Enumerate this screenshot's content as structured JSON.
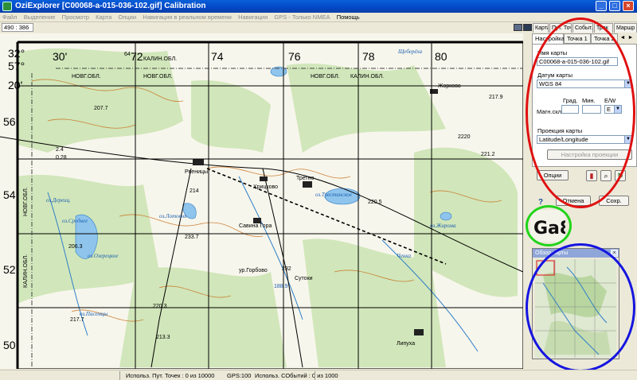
{
  "window": {
    "title": "OziExplorer [C00068-a-015-036-102.gif] Calibration",
    "controls": [
      "_",
      "□",
      "×"
    ]
  },
  "menu": {
    "items": [
      "Файл",
      "Выделение",
      "Просмотр",
      "Карта",
      "Опции",
      "Навигация в реальном времени",
      "Навигация",
      "GPS - Только NMEA",
      "Помощь"
    ]
  },
  "toolbar": {
    "coords": "490 : 386",
    "tabs": [
      "Карта",
      "Пут. Точ.",
      "Событ.",
      "Трек",
      "Маршр"
    ]
  },
  "map": {
    "grid_top": [
      "72",
      "74",
      "76",
      "78",
      "80"
    ],
    "grid_left": [
      "56",
      "54",
      "52",
      "50"
    ],
    "corner_lon": "32°",
    "corner_lon_min": "30'",
    "corner_lat": "57°",
    "corner_lat_min": "20'",
    "corner_small": "64",
    "border_labels": [
      "КАЛИН.ОБЛ.",
      "НОВГ.ОБЛ.",
      "НОВГ.ОБЛ.",
      "КАЛИН.ОБЛ.",
      "НОВГ.ОБЛ."
    ],
    "left_region": "КАЛИН.ОБЛ.",
    "left_region2": "НОВГ.ОБЛ.",
    "places": [
      "Щеберёха",
      "Жорково",
      "Рвеницы",
      "Хрицково",
      "Третно",
      "оз.Трестинское",
      "оз.Дереиц.",
      "оз.Среднее",
      "оз.Лотовнь",
      "оз.Озерецкое",
      "Савина Гора",
      "ур.Горбово",
      "Сутоки",
      "оз.Пасемцы",
      "Липуха",
      "оз.Жирома",
      "Ченка"
    ],
    "heights": [
      "207.7",
      "2.4",
      "0.28",
      "214",
      "233.7",
      "206.3",
      "220.5",
      "220.3",
      "217.7",
      "188.9",
      "232",
      "213.3",
      "2220",
      "217.9",
      "221.2"
    ]
  },
  "calibration": {
    "tabs": [
      "Настройка",
      "Точка 1",
      "Точка 2"
    ],
    "map_name_label": "Имя карты",
    "map_name_value": "C00068-a-015-036-102.gif",
    "datum_label": "Датум карты",
    "datum_value": "WGS 84",
    "deg_label": "Град.",
    "min_label": "Мин.",
    "ew_label": "E/W",
    "magn_label": "Магн.скл.",
    "ew_value": "E",
    "projection_label": "Проекция карты",
    "projection_value": "Latitude/Longitude",
    "projection_setup": "Настройка проекции",
    "options_button": "Опции",
    "cancel_button": "Отмена",
    "save_button": "Сохр.",
    "help": "?"
  },
  "overview": {
    "title": "Обзор карты",
    "close": "×"
  },
  "zoom_text": "Ga8",
  "status": {
    "waypoints": "Использ. Пут. Точек : 0 из 10000",
    "gps": "GPS:100",
    "events": "Использ. СОбытий : 0 из 1000"
  },
  "colors": {
    "titlebar": "#0347c7",
    "ellipse_red": "#e01010",
    "ellipse_green": "#22d41a",
    "ellipse_blue": "#1515e0",
    "grid": "#000000",
    "forest": "#cfe6b8",
    "water": "#8fc4ec",
    "contour": "#c8701e"
  }
}
